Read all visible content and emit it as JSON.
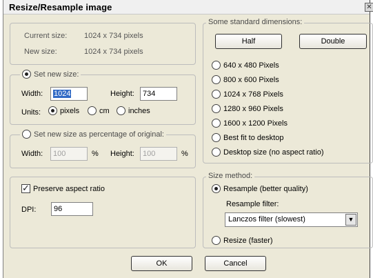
{
  "title": "Resize/Resample image",
  "close_glyph": "✕",
  "info": {
    "current_label": "Current size:",
    "current_value": "1024  x  734  pixels",
    "new_label": "New size:",
    "new_value": "1024  x  734  pixels"
  },
  "set_new_size": {
    "legend": "Set new size:",
    "width_label": "Width:",
    "width_value": "1024",
    "height_label": "Height:",
    "height_value": "734",
    "units_label": "Units:",
    "unit_pixels": "pixels",
    "unit_cm": "cm",
    "unit_inches": "inches"
  },
  "percentage": {
    "legend": "Set new size as percentage of original:",
    "width_label": "Width:",
    "width_value": "100",
    "height_label": "Height:",
    "height_value": "100",
    "pct": "%"
  },
  "aspect": {
    "preserve_label": "Preserve aspect ratio",
    "dpi_label": "DPI:",
    "dpi_value": "96"
  },
  "standard": {
    "legend": "Some standard dimensions:",
    "half": "Half",
    "double": "Double",
    "options": [
      "640 x 480 Pixels",
      "800 x 600 Pixels",
      "1024 x 768 Pixels",
      "1280 x 960 Pixels",
      "1600 x 1200 Pixels",
      "Best fit to desktop",
      "Desktop size (no aspect ratio)"
    ]
  },
  "method": {
    "legend": "Size method:",
    "resample": "Resample (better quality)",
    "filter_label": "Resample filter:",
    "filter_value": "Lanczos filter (slowest)",
    "resize": "Resize (faster)"
  },
  "buttons": {
    "ok": "OK",
    "cancel": "Cancel"
  }
}
